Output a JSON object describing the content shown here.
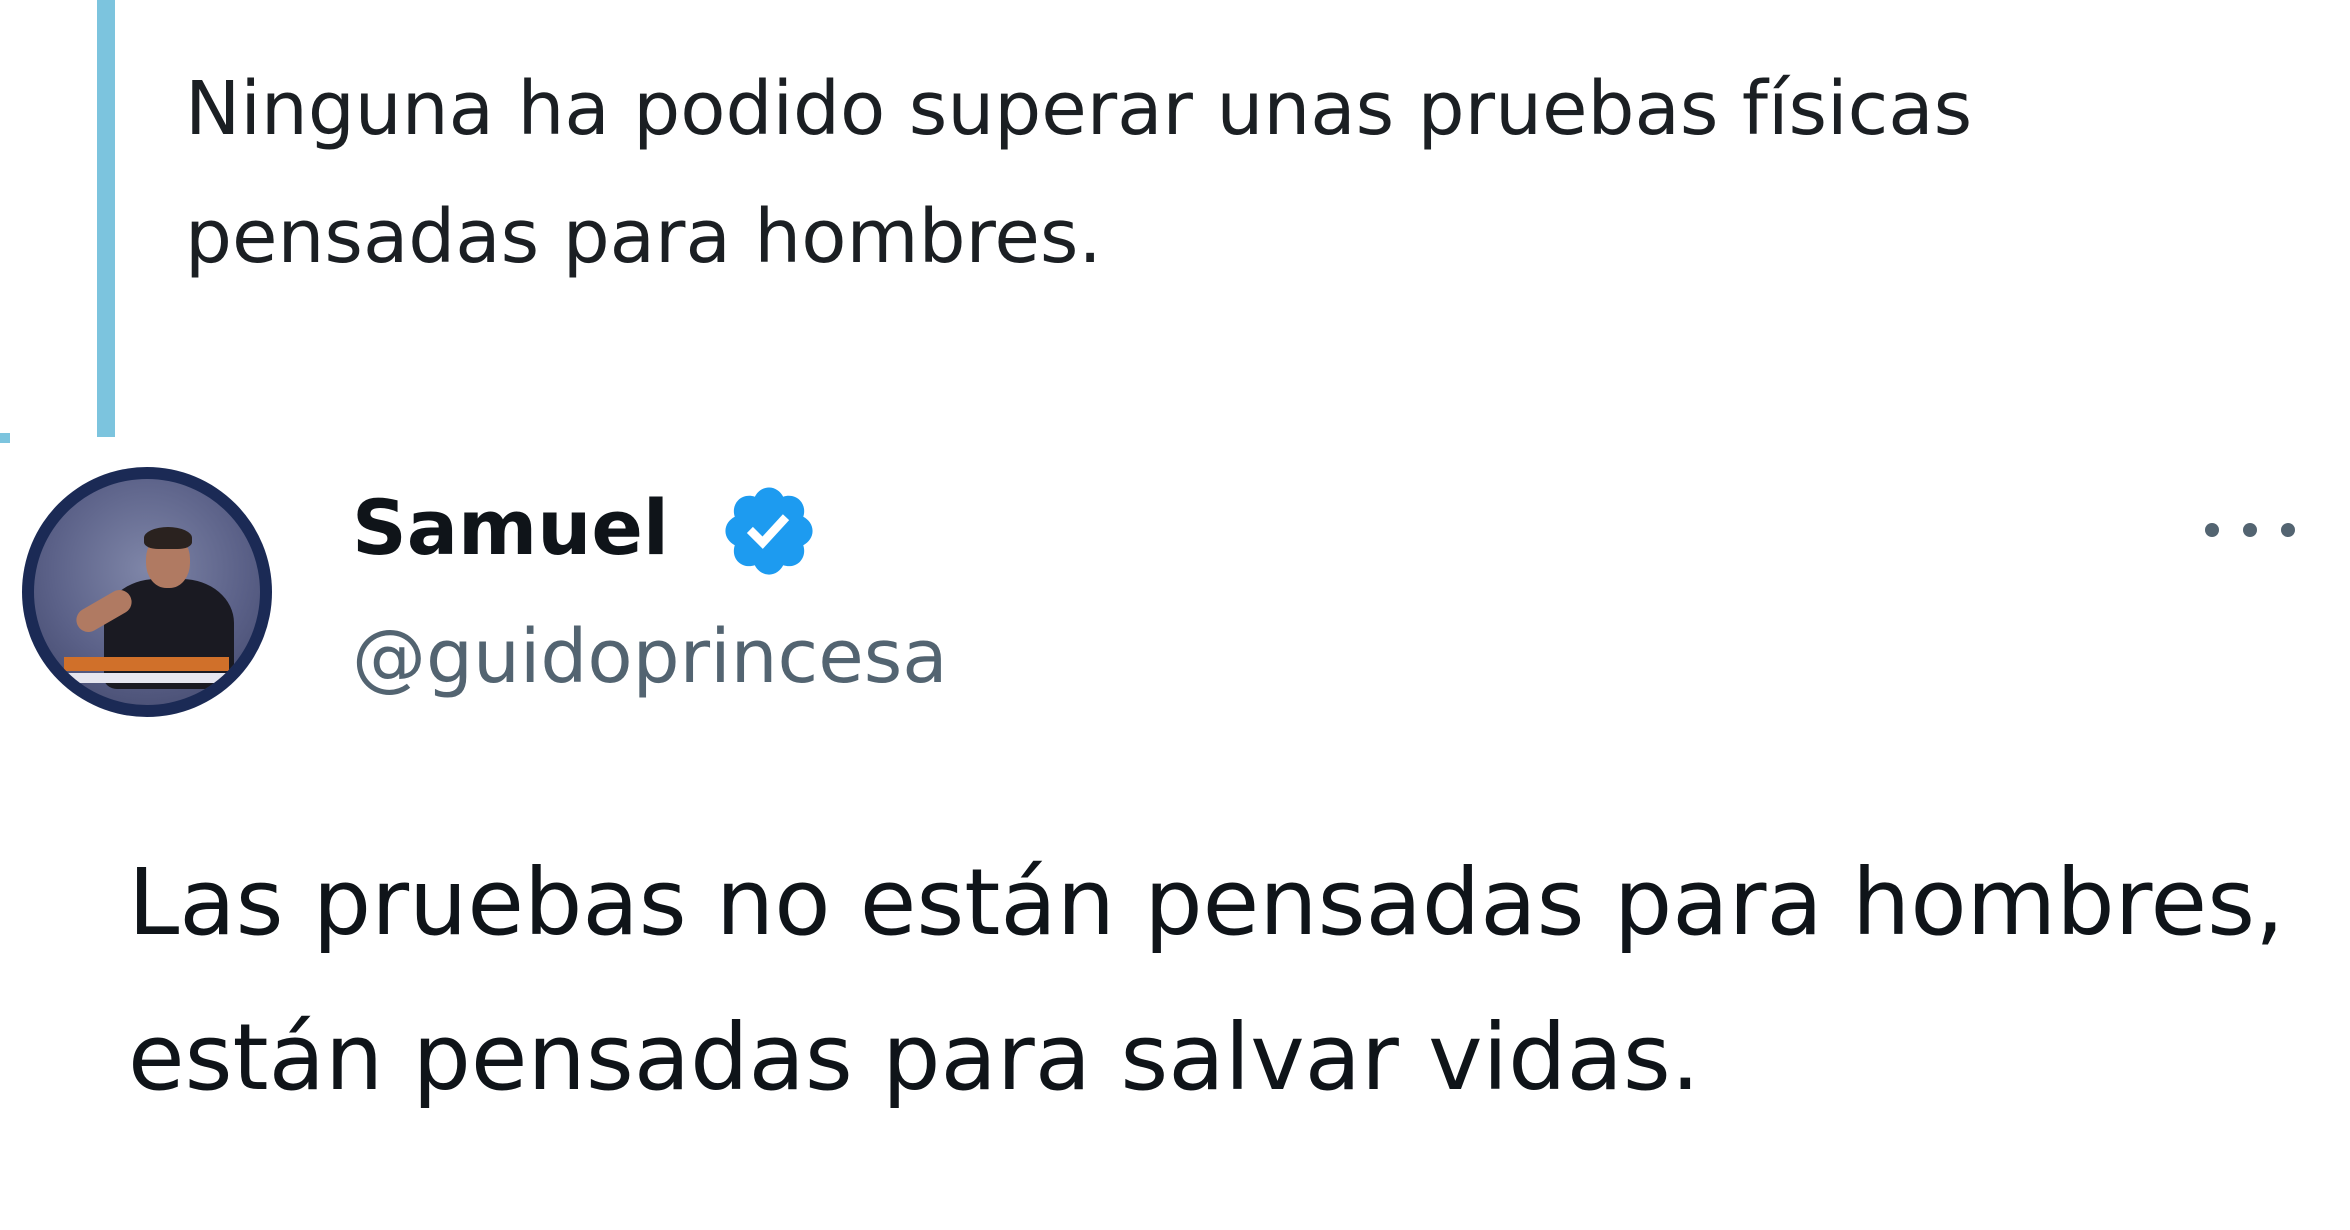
{
  "quoted_tweet": {
    "text": "Ninguna ha podido superar unas pruebas físicas pensadas para hombres."
  },
  "tweet": {
    "author": {
      "display_name": "Samuel",
      "handle": "@guidoprincesa",
      "verified": true,
      "avatar_icon": "avatar-photo"
    },
    "more_icon": "more-horizontal-icon",
    "text": "Las pruebas no están pensadas para hombres, están pensadas para salvar vidas."
  },
  "colors": {
    "quote_bar": "#7cc4de",
    "verified_badge": "#1d9bf0",
    "text_primary": "#0f1419",
    "text_secondary": "#536471"
  }
}
